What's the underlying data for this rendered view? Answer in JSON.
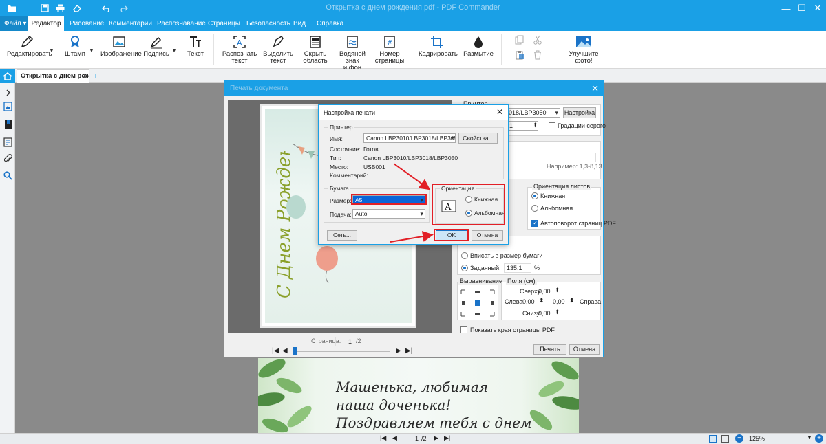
{
  "titlebar": {
    "window_title": "Открытка с днем рождения.pdf - PDF Commander"
  },
  "menubar": {
    "file": "Файл",
    "tabs": [
      "Редактор",
      "Рисование",
      "Комментарии",
      "Распознавание",
      "Страницы",
      "Безопасность",
      "Вид",
      "Справка"
    ],
    "active_tab": "Редактор"
  },
  "ribbon": {
    "edit": "Редактировать",
    "stamp": "Штамп",
    "image": "Изображение",
    "signature": "Подпись",
    "text": "Текст",
    "recognize_text": [
      "Распознать",
      "текст"
    ],
    "select_text": [
      "Выделить",
      "текст"
    ],
    "hide_area": [
      "Скрыть",
      "область"
    ],
    "watermark": [
      "Водяной знак",
      "и фон"
    ],
    "page_number": [
      "Номер",
      "страницы"
    ],
    "crop": "Кадрировать",
    "blur": "Размытие",
    "enhance_photo": "Улучшите фото!"
  },
  "doc_tab": {
    "title": "Открытка с днем рожд...",
    "close": "×",
    "add": "+"
  },
  "background_page": {
    "lines": [
      "Машенька, любимая",
      "наша доченька!",
      "Поздравляем тебя с днем"
    ]
  },
  "statusbar": {
    "page_current": "1",
    "page_total": "/2",
    "zoom": "125%"
  },
  "print_dialog": {
    "title": "Печать документа",
    "printer_group": "Принтер",
    "printer_name_tail": "3018/LBP3050",
    "settings_button": "Настройка",
    "copies_value": "1",
    "grayscale_label": "Градации серого",
    "range_example": "Например: 1,3-8,13",
    "sheet_orientation_group": "Ориентация листов",
    "portrait": "Книжная",
    "landscape": "Альбомная",
    "autorotate": "Автоповорот страниц PDF",
    "fit_paper": "Вписать в размер бумаги",
    "custom_scale_label": "Заданный:",
    "custom_scale_value": "135,1",
    "percent": "%",
    "align_group": "Выравнивание",
    "margins_group": "Поля (см)",
    "top_label": "Сверху",
    "left_label": "Слева",
    "right_label": "Справа",
    "bottom_label": "Снизу",
    "margin_value": "0,00",
    "show_edges": "Показать края страницы PDF",
    "page_label": "Страница:",
    "page_value": "1",
    "page_total": "/2",
    "print_button": "Печать",
    "cancel_button": "Отмена",
    "preview_text": "С Днем Рождения!"
  },
  "page_setup": {
    "title": "Настройка печати",
    "printer_group": "Принтер",
    "name_label": "Имя:",
    "name_value": "Canon LBP3010/LBP3018/LBP3050",
    "properties_button": "Свойства...",
    "status_label": "Состояние:",
    "status_value": "Готов",
    "type_label": "Тип:",
    "type_value": "Canon LBP3010/LBP3018/LBP3050",
    "location_label": "Место:",
    "location_value": "USB001",
    "comment_label": "Комментарий:",
    "paper_group": "Бумага",
    "size_label": "Размер:",
    "size_value": "A5",
    "source_label": "Подача:",
    "source_value": "Auto",
    "orientation_group": "Ориентация",
    "portrait": "Книжная",
    "landscape": "Альбомная",
    "orientation_selected": "landscape",
    "network_button": "Сеть...",
    "ok_button": "OK",
    "cancel_button": "Отмена"
  },
  "colors": {
    "accent": "#1aa0e6",
    "highlight": "#e21f26",
    "selection": "#0a64d8"
  }
}
